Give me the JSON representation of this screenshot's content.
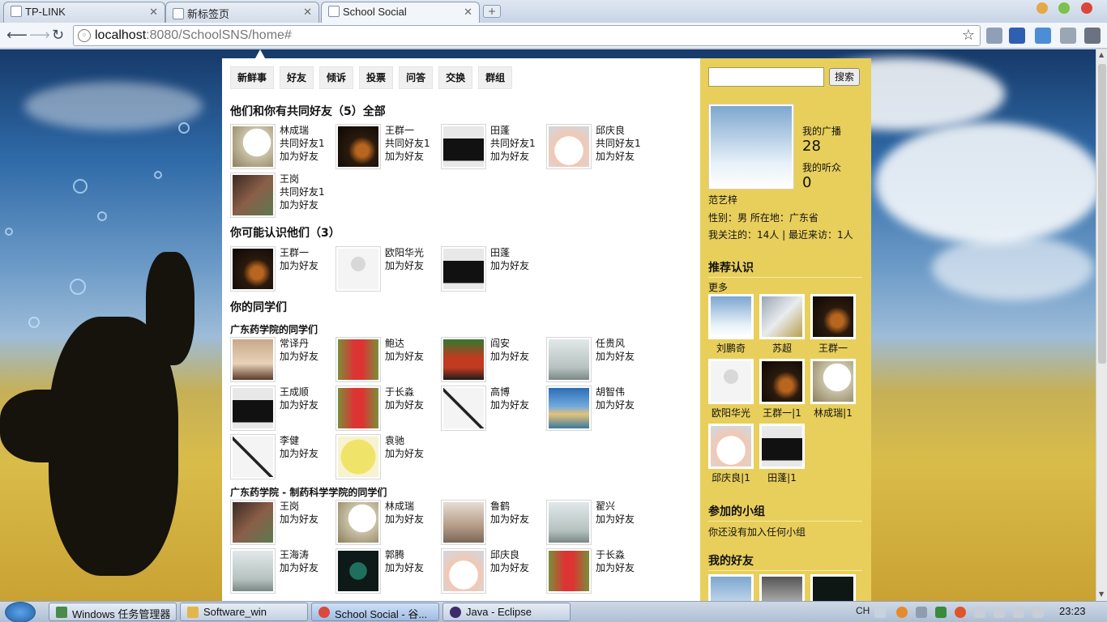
{
  "browser": {
    "tabs": [
      {
        "title": "TP-LINK"
      },
      {
        "title": "新标签页"
      },
      {
        "title": "School Social"
      }
    ],
    "url_host": "localhost",
    "url_rest": ":8080/SchoolSNS/home#"
  },
  "nav": [
    "新鲜事",
    "好友",
    "倾诉",
    "投票",
    "问答",
    "交换",
    "群组"
  ],
  "common": {
    "heading": "他们和你有共同好友（5）全部",
    "mutual_label": "共同好友1",
    "add_label": "加为好友",
    "users": [
      {
        "name": "林成瑞",
        "avatar": "clock"
      },
      {
        "name": "王群一",
        "avatar": "dark"
      },
      {
        "name": "田蓬",
        "avatar": "piano"
      },
      {
        "name": "邱庆良",
        "avatar": "snowman"
      },
      {
        "name": "王岗",
        "avatar": "hand"
      }
    ]
  },
  "maybe": {
    "heading": "你可能认识他们（3）",
    "users": [
      {
        "name": "王群一",
        "avatar": "dark"
      },
      {
        "name": "欧阳华光",
        "avatar": "default"
      },
      {
        "name": "田蓬",
        "avatar": "piano"
      }
    ]
  },
  "classmates": {
    "heading": "你的同学们",
    "groups": [
      {
        "title": "广东药学院的同学们",
        "users": [
          {
            "name": "常译丹",
            "avatar": "sunset"
          },
          {
            "name": "鲍达",
            "avatar": "tree"
          },
          {
            "name": "阎安",
            "avatar": "seats"
          },
          {
            "name": "任贵风",
            "avatar": "walker"
          },
          {
            "name": "王成顺",
            "avatar": "piano"
          },
          {
            "name": "于长淼",
            "avatar": "tree"
          },
          {
            "name": "高博",
            "avatar": "sticks"
          },
          {
            "name": "胡智伟",
            "avatar": "beach"
          },
          {
            "name": "李健",
            "avatar": "sticks"
          },
          {
            "name": "袁驰",
            "avatar": "mcd"
          }
        ]
      },
      {
        "title": "广东药学院 - 制药科学学院的同学们",
        "users": [
          {
            "name": "王岗",
            "avatar": "hand"
          },
          {
            "name": "林成瑞",
            "avatar": "clock"
          },
          {
            "name": "鲁鹤",
            "avatar": "girl"
          },
          {
            "name": "翟兴",
            "avatar": "walker"
          },
          {
            "name": "王海涛",
            "avatar": "walker"
          },
          {
            "name": "郭腾",
            "avatar": "joe"
          },
          {
            "name": "邱庆良",
            "avatar": "snowman"
          },
          {
            "name": "于长淼",
            "avatar": "tree"
          }
        ]
      }
    ]
  },
  "sidebar": {
    "search_button": "搜索",
    "broadcast_label": "我的广播",
    "broadcast_count": "28",
    "listeners_label": "我的听众",
    "listeners_count": "0",
    "username": "范艺梓",
    "info_line": "性别：男 所在地：广东省",
    "follow_line": "我关注的：14人 | 最近来访：1人",
    "recommend_heading": "推荐认识",
    "more_label": "更多",
    "recommend": [
      {
        "name": "刘鹏奇",
        "avatar": "chimes"
      },
      {
        "name": "苏超",
        "avatar": "can"
      },
      {
        "name": "王群一",
        "avatar": "dark"
      },
      {
        "name": "欧阳华光",
        "avatar": "default"
      },
      {
        "name": "王群一|1",
        "avatar": "dark"
      },
      {
        "name": "林成瑞|1",
        "avatar": "clock"
      },
      {
        "name": "邱庆良|1",
        "avatar": "snowman"
      },
      {
        "name": "田蓬|1",
        "avatar": "piano"
      }
    ],
    "groups_heading": "参加的小组",
    "groups_empty": "你还没有加入任何小组",
    "friends_heading": "我的好友"
  },
  "taskbar": {
    "tasks": [
      "Windows 任务管理器",
      "Software_win",
      "School Social - 谷...",
      "Java  -  Eclipse"
    ],
    "ime": "CH",
    "clock": "23:23"
  }
}
